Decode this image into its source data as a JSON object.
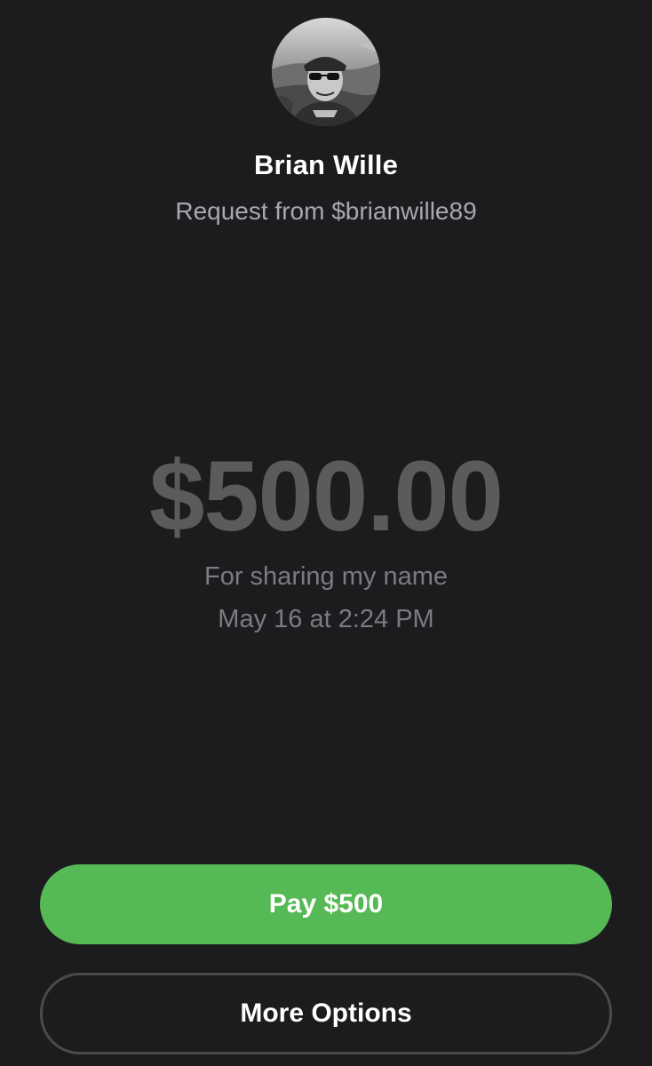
{
  "requester": {
    "avatar_icon": "profile-photo-avatar",
    "name": "Brian Wille",
    "subtitle": "Request from $brianwille89"
  },
  "request": {
    "amount": "$500.00",
    "note": "For sharing my name",
    "date": "May 16 at 2:24 PM"
  },
  "actions": {
    "pay_label": "Pay $500",
    "more_label": "More Options"
  },
  "colors": {
    "background": "#1c1c1e",
    "pay_button": "#55b955",
    "amount_text": "#5b5b5e",
    "secondary_text": "#a8a8ad"
  }
}
